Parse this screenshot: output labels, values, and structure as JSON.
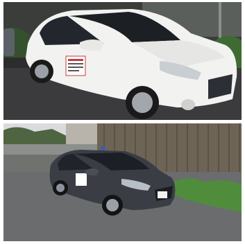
{
  "photos": [
    {
      "id": "top",
      "car_color": "white",
      "door_sign_text": "",
      "colors": {
        "body": "#f2f2f1",
        "road": "#3b3b3d",
        "glass": "#1c1f24",
        "greenery": "#3f6b33"
      }
    },
    {
      "id": "bottom",
      "car_color": "dark gray",
      "door_sign_text": "",
      "plate_text": "",
      "colors": {
        "body": "#3a3d44",
        "road": "#6b6c6e",
        "fence": "#6d6455",
        "greenery": "#4f8d3c"
      }
    }
  ]
}
